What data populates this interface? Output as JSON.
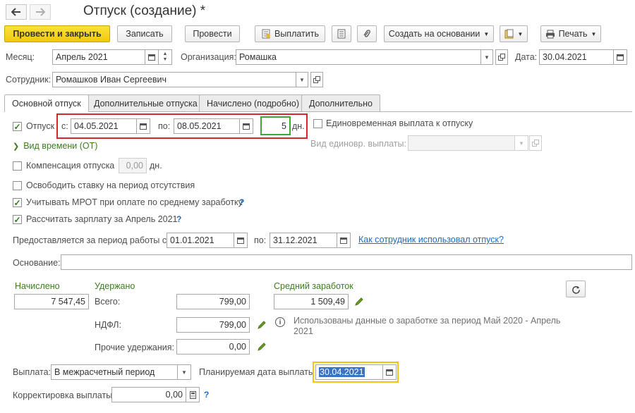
{
  "title": "Отпуск (создание) *",
  "toolbar": {
    "post_close": "Провести и закрыть",
    "save": "Записать",
    "post": "Провести",
    "pay": "Выплатить",
    "create_based": "Создать на основании",
    "print": "Печать"
  },
  "header": {
    "month_label": "Месяц:",
    "month_value": "Апрель 2021",
    "org_label": "Организация:",
    "org_value": "Ромашка",
    "date_label": "Дата:",
    "date_value": "30.04.2021",
    "employee_label": "Сотрудник:",
    "employee_value": "Ромашков Иван Сергеевич"
  },
  "tabs": [
    {
      "label": "Основной отпуск",
      "active": true
    },
    {
      "label": "Дополнительные отпуска",
      "active": false
    },
    {
      "label": "Начислено (подробно)",
      "active": false
    },
    {
      "label": "Дополнительно",
      "active": false
    }
  ],
  "vacation": {
    "checkbox_label": "Отпуск",
    "checked": true,
    "from_label": "с:",
    "from_value": "04.05.2021",
    "to_label": "по:",
    "to_value": "08.05.2021",
    "days_value": "5",
    "days_unit": "дн.",
    "time_kind_link": "Вид времени (ОТ)",
    "lump_sum_label": "Единовременная выплата к отпуску",
    "lump_sum_kind_label": "Вид единовр. выплаты:"
  },
  "compensation": {
    "label": "Компенсация отпуска",
    "value": "0,00",
    "unit": "дн."
  },
  "options": {
    "free_rate": "Освободить ставку на период отсутствия",
    "mrot": "Учитывать МРОТ при оплате по среднему заработку",
    "calc_salary": "Рассчитать зарплату за Апрель 2021",
    "help": "?"
  },
  "period": {
    "label": "Предоставляется за период работы с:",
    "from_value": "01.01.2021",
    "to_label": "по:",
    "to_value": "31.12.2021",
    "link": "Как сотрудник использовал отпуск?"
  },
  "basis": {
    "label": "Основание:",
    "value": ""
  },
  "totals": {
    "accrued_label": "Начислено",
    "accrued_value": "7 547,45",
    "withheld_label": "Удержано",
    "total_label": "Всего:",
    "total_value": "799,00",
    "ndfl_label": "НДФЛ:",
    "ndfl_value": "799,00",
    "other_label": "Прочие удержания:",
    "other_value": "0,00",
    "avg_label": "Средний заработок",
    "avg_value": "1 509,49",
    "info_text": "Использованы данные о заработке за период Май 2020 - Апрель 2021"
  },
  "payment": {
    "label": "Выплата:",
    "value": "В межрасчетный период",
    "planned_label": "Планируемая дата выплаты:",
    "planned_value": "30.04.2021",
    "correction_label": "Корректировка выплаты:",
    "correction_value": "0,00"
  },
  "colors": {
    "primary_button": "#f5d21c",
    "green_label": "#3a7d1e",
    "link": "#1a6bc4",
    "highlight_red": "#d9262c",
    "highlight_green": "#3aaa35",
    "highlight_yellow": "#f0c419",
    "selection": "#3a72c4"
  }
}
